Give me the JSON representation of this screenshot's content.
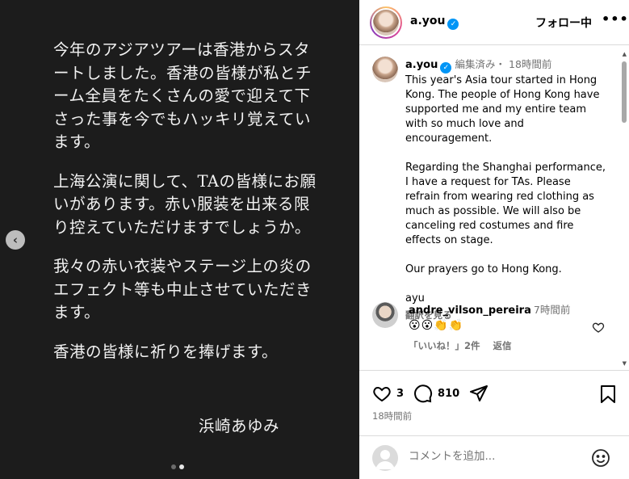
{
  "media": {
    "paragraphs": [
      "今年のアジアツアーは香港からスタートしました。香港の皆様が私とチーム全員をたくさんの愛で迎えて下さった事を今でもハッキリ覚えています。",
      "上海公演に関して、TAの皆様にお願いがあります。赤い服装を出来る限り控えていただけますでしょうか。",
      "我々の赤い衣装やステージ上の炎のエフェクト等も中止させていただきます。",
      "香港の皆様に祈りを捧げます。"
    ],
    "signature": "浜崎あゆみ",
    "prev_icon": "‹"
  },
  "header": {
    "username": "a.you",
    "follow_label": "フォロー中",
    "more_icon": "•••"
  },
  "caption": {
    "username": "a.you",
    "meta": "編集済み・ 18時間前",
    "paragraphs": [
      "This year's Asia tour started in Hong Kong. The people of Hong Kong have supported me and my entire team with so much love and encouragement.",
      "Regarding the Shanghai performance, I have a request for TAs. Please refrain from wearing red clothing as much as possible. We will also be canceling red costumes and fire effects on stage.",
      "Our prayers go to Hong Kong."
    ],
    "sign": "ayu",
    "translate_label": "翻訳を見る"
  },
  "comment": {
    "username": "andre_vilson_pereira",
    "time": "7時間前",
    "text": "😮😮👏👏",
    "likes_label": "「いいね！」2件",
    "reply_label": "返信"
  },
  "actions": {
    "like_count": "3",
    "comment_count": "810",
    "time": "18時間前",
    "comment_placeholder": "コメントを追加..."
  },
  "colors": {
    "verified": "#0095f6",
    "media_bg": "#1c1c1c",
    "muted": "#737373"
  }
}
